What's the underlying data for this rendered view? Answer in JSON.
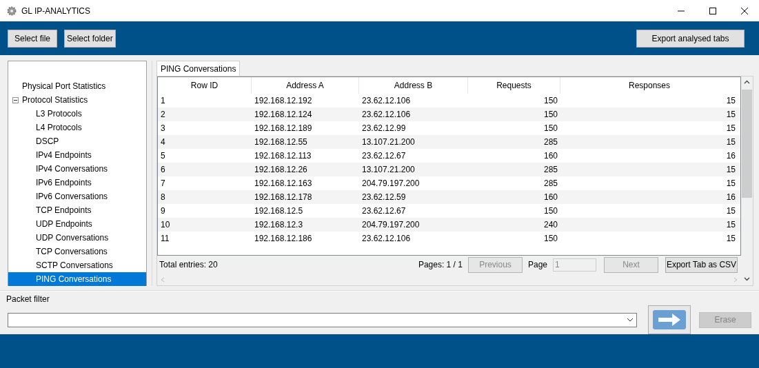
{
  "window": {
    "title": "GL IP-ANALYTICS"
  },
  "toolbar": {
    "buttons": [
      {
        "label": "Select file"
      },
      {
        "label": "Select folder"
      }
    ],
    "export_button": "Export analysed tabs"
  },
  "tree": [
    {
      "label": "Physical Port Statistics",
      "selected": false
    },
    {
      "label": "Protocol Statistics",
      "selected": false,
      "expanded": true,
      "children": [
        {
          "label": "L3 Protocols",
          "selected": false
        },
        {
          "label": "L4 Protocols",
          "selected": false
        },
        {
          "label": "DSCP",
          "selected": false
        },
        {
          "label": "IPv4 Endpoints",
          "selected": false
        },
        {
          "label": "IPv4 Conversations",
          "selected": false
        },
        {
          "label": "IPv6 Endpoints",
          "selected": false
        },
        {
          "label": "IPv6 Conversations",
          "selected": false
        },
        {
          "label": "TCP Endpoints",
          "selected": false
        },
        {
          "label": "UDP Endpoints",
          "selected": false
        },
        {
          "label": "UDP Conversations",
          "selected": false
        },
        {
          "label": "TCP Conversations",
          "selected": false
        },
        {
          "label": "SCTP Conversations",
          "selected": false
        },
        {
          "label": "PING Conversations",
          "selected": true
        }
      ]
    }
  ],
  "tabs": [
    {
      "label": "PING Conversations",
      "selected": true
    }
  ],
  "table": {
    "columns": [
      "Row ID",
      "Address A",
      "Address B",
      "Requests",
      "Responses"
    ],
    "rows": [
      [
        "1",
        "192.168.12.192",
        "23.62.12.106",
        "150",
        "15"
      ],
      [
        "2",
        "192.168.12.124",
        "23.62.12.106",
        "150",
        "15"
      ],
      [
        "3",
        "192.168.12.189",
        "23.62.12.99",
        "150",
        "15"
      ],
      [
        "4",
        "192.168.12.55",
        "13.107.21.200",
        "285",
        "15"
      ],
      [
        "5",
        "192.168.12.113",
        "23.62.12.67",
        "160",
        "16"
      ],
      [
        "6",
        "192.168.12.26",
        "13.107.21.200",
        "285",
        "15"
      ],
      [
        "7",
        "192.168.12.163",
        "204.79.197.200",
        "285",
        "15"
      ],
      [
        "8",
        "192.168.12.178",
        "23.62.12.59",
        "160",
        "16"
      ],
      [
        "9",
        "192.168.12.5",
        "23.62.12.67",
        "150",
        "15"
      ],
      [
        "10",
        "192.168.12.3",
        "204.79.197.200",
        "240",
        "15"
      ],
      [
        "11",
        "192.168.12.186",
        "23.62.12.106",
        "150",
        "15"
      ]
    ]
  },
  "pager": {
    "total": "Total entries: 20",
    "pages": "Pages: 1 / 1",
    "previous": {
      "label": "Previous",
      "disabled": true
    },
    "page_label": "Page",
    "page_field": {
      "value": "1",
      "disabled": true
    },
    "next": {
      "label": "Next",
      "disabled": true
    },
    "export": {
      "label": "Export Tab as CSV",
      "disabled": false
    }
  },
  "packet_filter": {
    "label": "Packet filter",
    "erase": {
      "label": "Erase",
      "disabled": true
    }
  }
}
